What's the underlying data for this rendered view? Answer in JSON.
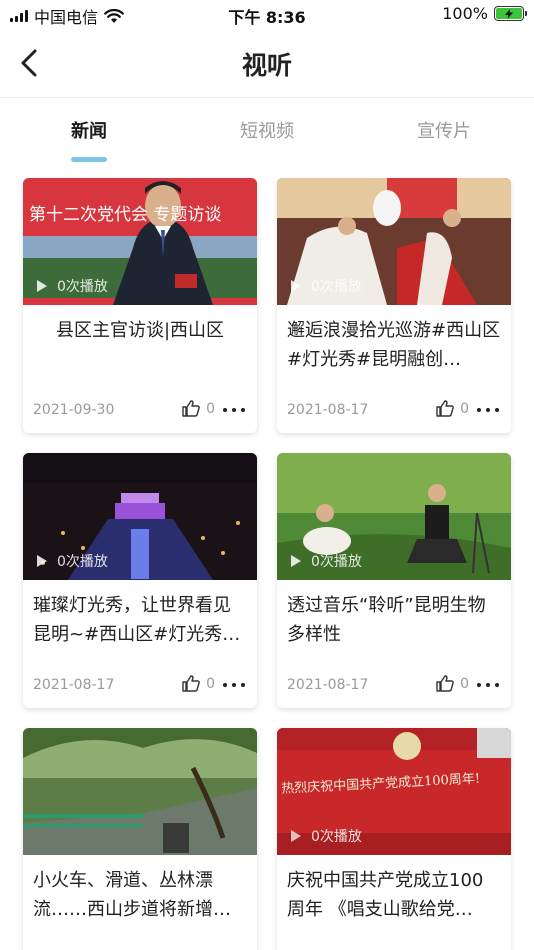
{
  "status_bar": {
    "carrier": "中国电信",
    "time": "下午 8:36",
    "battery": "100%"
  },
  "header": {
    "title": "视听"
  },
  "tabs": [
    {
      "label": "新闻",
      "active": true
    },
    {
      "label": "短视频",
      "active": false
    },
    {
      "label": "宣传片",
      "active": false
    }
  ],
  "colors": {
    "accent": "#7dc6e6",
    "battery": "#3cc43c"
  },
  "cards": [
    {
      "title": "县区主官访谈|西山区",
      "date": "2021-09-30",
      "likes": "0",
      "plays": "0次播放",
      "banner_text": "第十二次党代会 专题访谈"
    },
    {
      "title": "邂逅浪漫拾光巡游#西山区#灯光秀#昆明融创…",
      "date": "2021-08-17",
      "likes": "0",
      "plays": "0次播放"
    },
    {
      "title": "璀璨灯光秀，让世界看见昆明~#西山区#灯光秀…",
      "date": "2021-08-17",
      "likes": "0",
      "plays": "0次播放"
    },
    {
      "title": "透过音乐“聆听”昆明生物多样性",
      "date": "2021-08-17",
      "likes": "0",
      "plays": "0次播放"
    },
    {
      "title": "小火车、滑道、丛林漂流……西山步道将新增…",
      "date": "",
      "likes": "",
      "plays": ""
    },
    {
      "title": "庆祝中国共产党成立100周年 《唱支山歌给党…",
      "date": "",
      "likes": "",
      "plays": "0次播放",
      "banner_text": "热烈庆祝中国共产党成立100周年!"
    }
  ]
}
